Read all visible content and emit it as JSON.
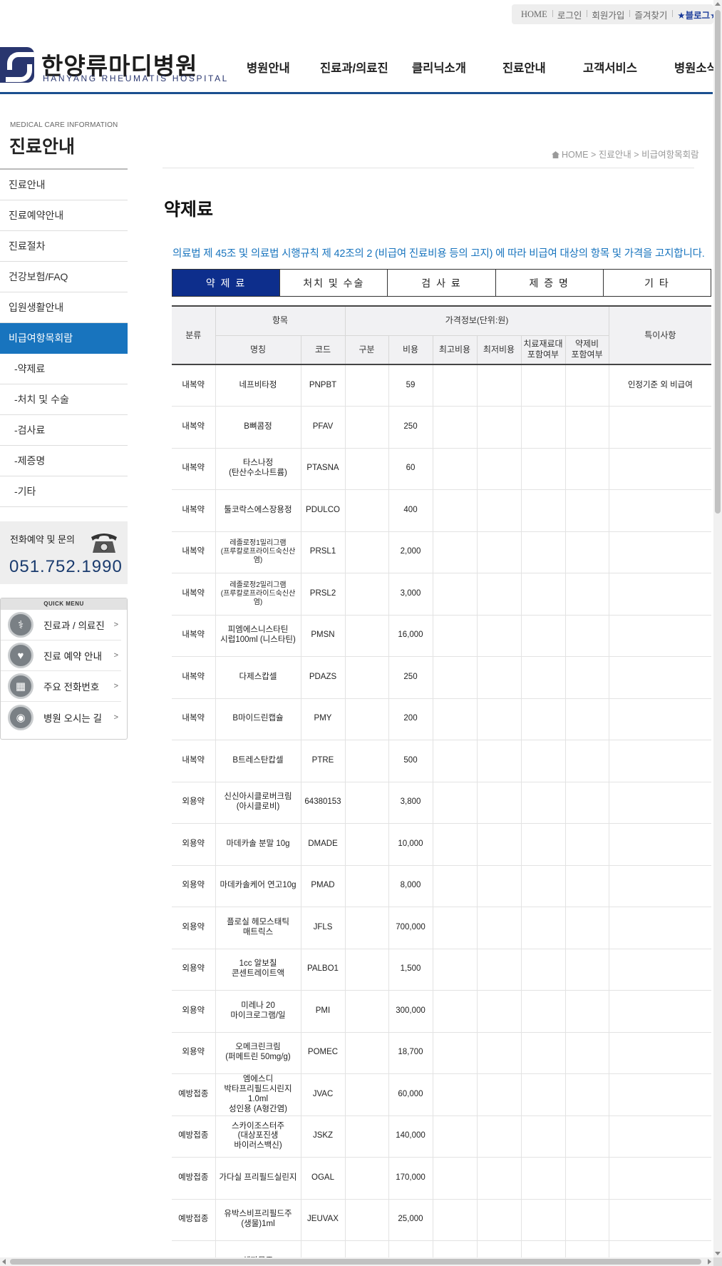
{
  "util_links": [
    "HOME",
    "로그인",
    "회원가입",
    "즐겨찾기",
    "★블로그★"
  ],
  "logo": {
    "ko": "한양류마디병원",
    "en": "HANYANG RHEUMATIS HOSPITAL"
  },
  "gnb": [
    "병원안내",
    "진료과/의료진",
    "클리닉소개",
    "진료안내",
    "고객서비스",
    "병원소식"
  ],
  "sidebar": {
    "subtitle": "MEDICAL CARE INFORMATION",
    "title": "진료안내",
    "items": [
      {
        "label": "진료안내",
        "type": "main"
      },
      {
        "label": "진료예약안내",
        "type": "main"
      },
      {
        "label": "진료절차",
        "type": "main"
      },
      {
        "label": "건강보험/FAQ",
        "type": "main"
      },
      {
        "label": "입원생활안내",
        "type": "main"
      },
      {
        "label": "비급여항목회람",
        "type": "active"
      },
      {
        "label": "-약제료",
        "type": "sub"
      },
      {
        "label": "-처치 및 수술",
        "type": "sub"
      },
      {
        "label": "-검사료",
        "type": "sub"
      },
      {
        "label": "-제증명",
        "type": "sub"
      },
      {
        "label": "-기타",
        "type": "sub"
      }
    ],
    "tel": {
      "label": "전화예약 및 문의",
      "number": "051.752.1990"
    },
    "quick_menu": {
      "title": "QUICK MENU",
      "items": [
        "진료과 / 의료진",
        "진료 예약 안내",
        "주요 전화번호",
        "병원 오시는 길"
      ]
    }
  },
  "breadcrumb": {
    "home": "HOME",
    "level1": "진료안내",
    "level2": "비급여항목회람"
  },
  "page_title": "약제료",
  "notice": "의료법 제 45조 및 의료법 시행규칙 제 42조의 2 (비급여 진료비용 등의 고지) 에 따라 비급여 대상의 항목 및 가격을 고지합니다.",
  "tabs": [
    "약 제 료",
    "처치 및 수술",
    "검 사 료",
    "제 증 명",
    "기   타"
  ],
  "table": {
    "headers": {
      "category": "분류",
      "item": "항목",
      "price_info": "가격정보(단위:원)",
      "notes": "특이사항",
      "name": "명칭",
      "code": "코드",
      "division": "구분",
      "cost": "비용",
      "max_cost": "최고비용",
      "min_cost": "최저비용",
      "material": "치료재료대\n포함여부",
      "drug": "약제비\n포함여부"
    },
    "rows": [
      {
        "cat": "내복약",
        "name": "네프비타정",
        "code": "PNPBT",
        "cost": "59",
        "note": "인정기준 외 비급여",
        "group_start": false
      },
      {
        "cat": "내복약",
        "name": "B뼈콤정",
        "code": "PFAV",
        "cost": "250",
        "note": "",
        "group_start": false
      },
      {
        "cat": "내복약",
        "name": "타스나정\n(탄산수소나트륨)",
        "code": "PTASNA",
        "cost": "60",
        "note": "",
        "group_start": false
      },
      {
        "cat": "내복약",
        "name": "툴코락스에스장용정",
        "code": "PDULCO",
        "cost": "400",
        "note": "",
        "group_start": false
      },
      {
        "cat": "내복약",
        "name": "레졸로정1밀리그램\n(프루칼로프라이드숙신산염)",
        "code": "PRSL1",
        "cost": "2,000",
        "note": "",
        "group_start": false,
        "small": true
      },
      {
        "cat": "내복약",
        "name": "레졸로정2밀리그램\n(프루칼로프라이드숙신산염)",
        "code": "PRSL2",
        "cost": "3,000",
        "note": "",
        "group_start": true,
        "small": true
      },
      {
        "cat": "내복약",
        "name": "피엠에스니스타틴\n시럽100ml (니스타틴)",
        "code": "PMSN",
        "cost": "16,000",
        "note": "",
        "group_start": false
      },
      {
        "cat": "내복약",
        "name": "다제스캅셀",
        "code": "PDAZS",
        "cost": "250",
        "note": "",
        "group_start": false
      },
      {
        "cat": "내복약",
        "name": "B마이드린캡슐",
        "code": "PMY",
        "cost": "200",
        "note": "",
        "group_start": false
      },
      {
        "cat": "내복약",
        "name": "B트레스탄캅셀",
        "code": "PTRE",
        "cost": "500",
        "note": "",
        "group_start": false
      },
      {
        "cat": "외용약",
        "name": "신신아시클로버크림\n(아시클로비)",
        "code": "64380153",
        "cost": "3,800",
        "note": "",
        "group_start": false
      },
      {
        "cat": "외용약",
        "name": "마데카솔 분말 10g",
        "code": "DMADE",
        "cost": "10,000",
        "note": "",
        "group_start": false
      },
      {
        "cat": "외용약",
        "name": "마데카솔케어 연고10g",
        "code": "PMAD",
        "cost": "8,000",
        "note": "",
        "group_start": false
      },
      {
        "cat": "외용약",
        "name": "플로실 헤모스태틱\n매트릭스",
        "code": "JFLS",
        "cost": "700,000",
        "note": "",
        "group_start": false
      },
      {
        "cat": "외용약",
        "name": "1cc 알보칠\n콘센트레이트액",
        "code": "PALBO1",
        "cost": "1,500",
        "note": "",
        "group_start": false
      },
      {
        "cat": "외용약",
        "name": "미레나 20\n마이크로그램/일",
        "code": "PMI",
        "cost": "300,000",
        "note": "",
        "group_start": false
      },
      {
        "cat": "외용약",
        "name": "오메크린크림\n(퍼메트린 50mg/g)",
        "code": "POMEC",
        "cost": "18,700",
        "note": "",
        "group_start": false
      },
      {
        "cat": "예방접종",
        "name": "엠에스디\n박타프리필드시린지1.0ml\n성인용 (A형간염)",
        "code": "JVAC",
        "cost": "60,000",
        "note": "",
        "group_start": true
      },
      {
        "cat": "예방접종",
        "name": "스카이조스터주\n(대상포진생\n바이러스백신)",
        "code": "JSKZ",
        "cost": "140,000",
        "note": "",
        "group_start": false
      },
      {
        "cat": "예방접종",
        "name": "가다실 프리필드실린지",
        "code": "OGAL",
        "cost": "170,000",
        "note": "",
        "group_start": false
      },
      {
        "cat": "예방접종",
        "name": "유박스비프리필드주\n(생물)1ml",
        "code": "JEUVAX",
        "cost": "25,000",
        "note": "",
        "group_start": false
      },
      {
        "cat": "",
        "name": "헤파뮨주",
        "code": "",
        "cost": "",
        "note": "",
        "group_start": false
      }
    ]
  },
  "colors": {
    "nav_line": "#1b4f8f",
    "active_side": "#1874be",
    "active_tab": "#0d2e8c",
    "notice_text": "#1874be"
  }
}
